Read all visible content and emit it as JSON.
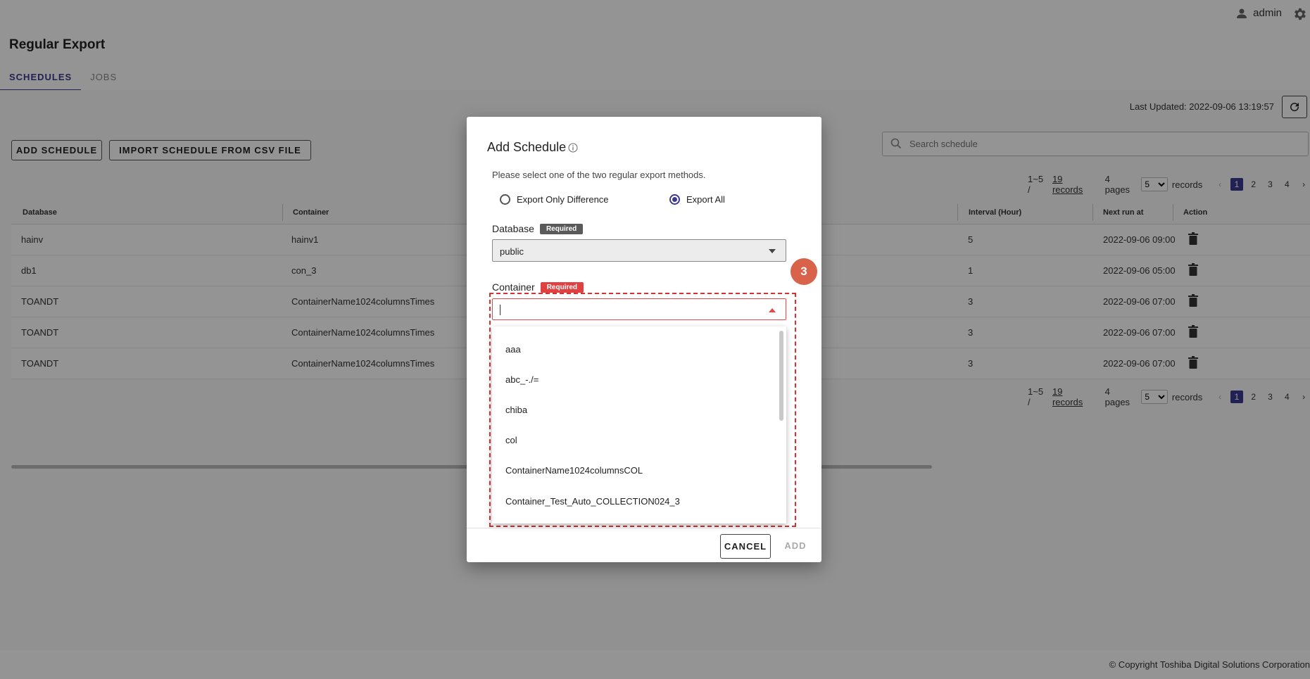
{
  "header": {
    "username": "admin"
  },
  "page": {
    "title": "Regular Export",
    "tabs": [
      {
        "label": "SCHEDULES",
        "active": true
      },
      {
        "label": "JOBS",
        "active": false
      }
    ]
  },
  "toolbar": {
    "last_updated": "Last Updated: 2022-09-06 13:19:57",
    "add_schedule": "ADD SCHEDULE",
    "import_csv": "IMPORT SCHEDULE FROM CSV FILE",
    "search_placeholder": "Search schedule"
  },
  "pagination": {
    "range": "1~5 /",
    "records_link": "19 records",
    "pages": "4 pages",
    "per_page": "5",
    "records_label": "records",
    "page_numbers": [
      "1",
      "2",
      "3",
      "4"
    ],
    "prev": "‹",
    "next": "›"
  },
  "table": {
    "headers": {
      "database": "Database",
      "container": "Container",
      "interval": "Interval (Hour)",
      "next_run": "Next run at",
      "action": "Action"
    },
    "rows": [
      {
        "database": "hainv",
        "container": "hainv1",
        "interval": "5",
        "next_run": "2022-09-06 09:00"
      },
      {
        "database": "db1",
        "container": "con_3",
        "interval": "1",
        "next_run": "2022-09-06 05:00"
      },
      {
        "database": "TOANDT",
        "container": "ContainerName1024columnsTimes",
        "interval": "3",
        "next_run": "2022-09-06 07:00"
      },
      {
        "database": "TOANDT",
        "container": "ContainerName1024columnsTimes",
        "interval": "3",
        "next_run": "2022-09-06 07:00"
      },
      {
        "database": "TOANDT",
        "container": "ContainerName1024columnsTimes",
        "interval": "3",
        "next_run": "2022-09-06 07:00"
      }
    ]
  },
  "footer": {
    "copyright": "© Copyright Toshiba Digital Solutions Corporation"
  },
  "modal": {
    "title": "Add Schedule",
    "description": "Please select one of the two regular export methods.",
    "option_difference": "Export Only Difference",
    "option_all": "Export All",
    "selected_option": "Export All",
    "database_label": "Database",
    "required": "Required",
    "database_value": "public",
    "container_label": "Container",
    "container_value": "",
    "container_options": [
      "aaa",
      "abc_-./=",
      "chiba",
      "col",
      "ContainerName1024columnsCOL",
      "Container_Test_Auto_COLLECTION024_3"
    ],
    "step_number": "3",
    "cancel": "CANCEL",
    "add": "ADD"
  },
  "colors": {
    "accent": "#3c3a8f",
    "required": "#e04040",
    "step_badge": "#d9634a"
  }
}
